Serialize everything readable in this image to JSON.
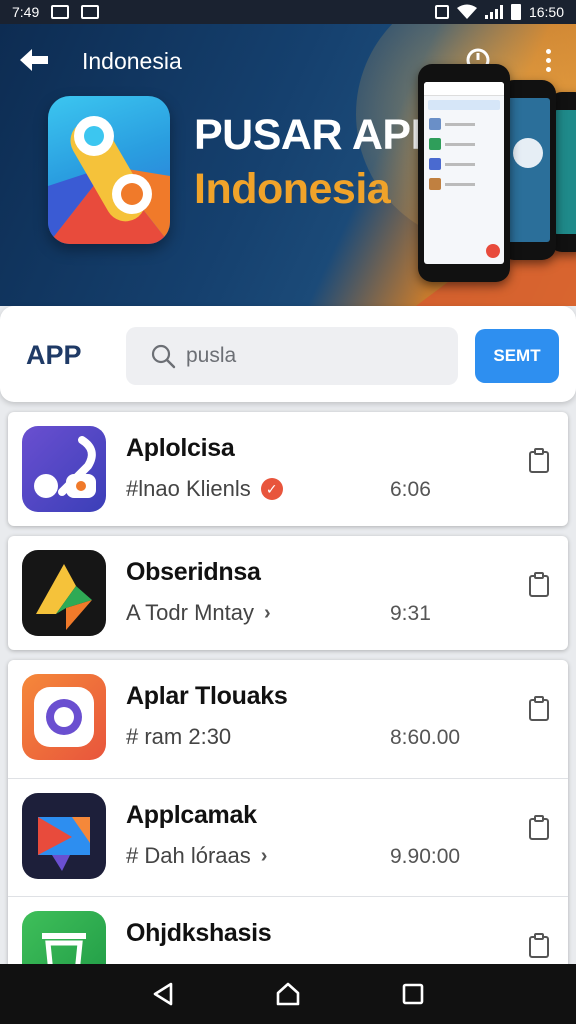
{
  "status_bar": {
    "time": "7:49",
    "clock_right": "16:50"
  },
  "header": {
    "title": "Indonesia",
    "brand_title": "PUSAR APP",
    "brand_subtitle": "Indonesia"
  },
  "search": {
    "label": "APP",
    "placeholder": "pusla",
    "button_label": "SEMT"
  },
  "apps": [
    {
      "name": "Aplolcisa",
      "tag": "#lnao Klienls",
      "time": "6:06",
      "badge": "verified",
      "icon": "phone-app-icon"
    },
    {
      "name": "Obseridnsa",
      "tag": "A Todr Mntay",
      "time": "9:31",
      "badge": "chevron",
      "icon": "arrow-app-icon"
    },
    {
      "name": "Aplar Tlouaks",
      "tag": "# ram 2:30",
      "time": "8:60.00",
      "badge": "none",
      "icon": "camera-app-icon"
    },
    {
      "name": "Applcamak",
      "tag": "# Dah lóraas",
      "time": "9.90:00",
      "badge": "chevron",
      "icon": "play-app-icon"
    },
    {
      "name": "Ohjdkshasis",
      "tag": "",
      "time": "",
      "badge": "none",
      "icon": "trash-app-icon"
    }
  ],
  "colors": {
    "accent": "#2e8ff0",
    "brand_orange": "#f0a32a",
    "header_navy": "#15406e"
  }
}
